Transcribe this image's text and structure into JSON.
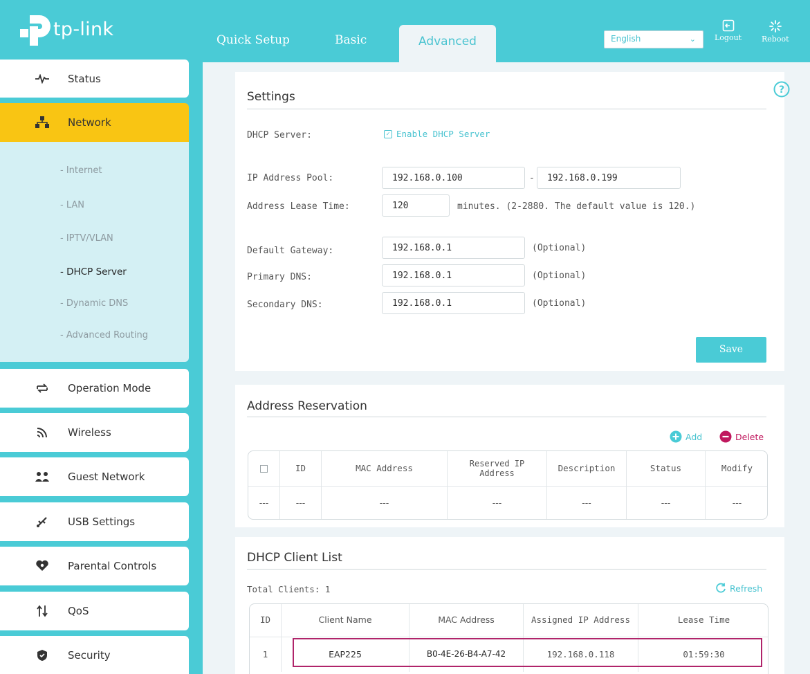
{
  "header": {
    "brand": "tp-link",
    "tabs": [
      "Quick Setup",
      "Basic",
      "Advanced"
    ],
    "active_tab": "Advanced",
    "language": "English",
    "logout_label": "Logout",
    "reboot_label": "Reboot"
  },
  "sidebar": {
    "items": [
      {
        "label": "Status",
        "icon": "pulse-icon"
      },
      {
        "label": "Network",
        "icon": "network-icon",
        "active": true
      },
      {
        "label": "Operation Mode",
        "icon": "swap-icon"
      },
      {
        "label": "Wireless",
        "icon": "wifi-icon"
      },
      {
        "label": "Guest Network",
        "icon": "guest-users-icon"
      },
      {
        "label": "USB Settings",
        "icon": "usb-icon"
      },
      {
        "label": "Parental Controls",
        "icon": "heart-icon"
      },
      {
        "label": "QoS",
        "icon": "qos-arrows-icon"
      },
      {
        "label": "Security",
        "icon": "shield-icon"
      }
    ],
    "submenu": [
      "- Internet",
      "- LAN",
      "- IPTV/VLAN",
      "- DHCP Server",
      "- Dynamic DNS",
      "- Advanced Routing"
    ],
    "current_submenu": "- DHCP Server"
  },
  "settings": {
    "title": "Settings",
    "dhcp_server_label": "DHCP Server:",
    "enable_label": "Enable DHCP Server",
    "enabled": true,
    "ip_pool_label": "IP Address Pool:",
    "ip_pool_start": "192.168.0.100",
    "ip_pool_sep": "-",
    "ip_pool_end": "192.168.0.199",
    "lease_label": "Address Lease Time:",
    "lease_value": "120",
    "lease_note": "minutes. (2-2880. The default value is 120.)",
    "gateway_label": "Default Gateway:",
    "gateway_value": "192.168.0.1",
    "primary_dns_label": "Primary DNS:",
    "primary_dns_value": "192.168.0.1",
    "secondary_dns_label": "Secondary DNS:",
    "secondary_dns_value": "192.168.0.1",
    "optional": "(Optional)",
    "save_label": "Save"
  },
  "reservation": {
    "title": "Address Reservation",
    "add_label": "Add",
    "delete_label": "Delete",
    "columns": [
      "ID",
      "MAC Address",
      "Reserved IP Address",
      "Description",
      "Status",
      "Modify"
    ],
    "rows": [
      [
        "---",
        "---",
        "---",
        "---",
        "---",
        "---",
        "---"
      ]
    ]
  },
  "clients": {
    "title": "DHCP Client List",
    "total_label": "Total Clients: 1",
    "refresh_label": "Refresh",
    "columns": [
      "ID",
      "Client Name",
      "MAC Address",
      "Assigned IP Address",
      "Lease Time"
    ],
    "rows": [
      [
        "1",
        "EAP225",
        "B0-4E-26-B4-A7-42",
        "192.168.0.118",
        "01:59:30"
      ]
    ]
  },
  "colors": {
    "accent": "#4acbd6",
    "active_nav": "#f9c513",
    "delete": "#c0185e",
    "highlight": "#b0246a"
  }
}
